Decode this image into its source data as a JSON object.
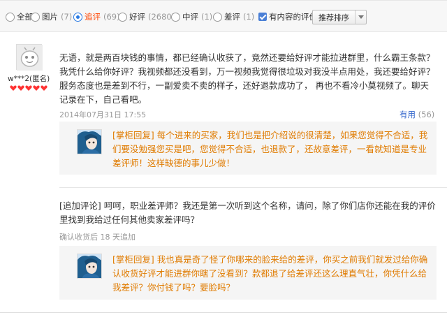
{
  "filters": {
    "all": {
      "label": "全部"
    },
    "pictures": {
      "label": "图片",
      "count": "(7)"
    },
    "followup": {
      "label": "追评",
      "count": "(69)"
    },
    "positive": {
      "label": "好评",
      "count": "(2680)"
    },
    "neutral": {
      "label": "中评",
      "count": "(1)"
    },
    "negative": {
      "label": "差评",
      "count": "(1)"
    },
    "with_content": {
      "label": "有内容的评价",
      "checked": true
    },
    "sort": {
      "selected": "推荐排序"
    },
    "selected_filter": "followup"
  },
  "review": {
    "username": "w***2(匿名)",
    "rank_icon_count": 5,
    "rank_color": "#ff3333",
    "text": "无语，就是两百块钱的事情，都已经确认收获了，竟然还要给好评才能拉进群里，什么霸王条款？我凭什么给你好评？我视频都还没看到，万一视频我觉得很垃圾对我没半点用处，我还要给好评？服务态度也是差到不行，一副爱卖不卖的样子，还好退款成功了， 再也不看冷小莫视频了。聊天记录在下，自己看吧。",
    "date": "2014年07月31日 17:55",
    "useful_label": "有用",
    "useful_count": "(56)",
    "reply": "[掌柜回复] 每个进来的买家，我们也是把介绍说的很清楚，如果您觉得不合适，我们要没勉强您买是吧，您觉得不合适，也退款了，还故意差评，一看就知道是专业差评师！这样缺德的事儿少做！",
    "followup": {
      "text": "[追加评论] 呵呵，职业差评师？我还是第一次听到这个名称，请问，除了你们店你还能在我的评价里找到我给过任何其他卖家差评吗？",
      "meta": "确认收货后 18 天追加",
      "reply": "[掌柜回复] 我也真是奇了怪了你哪来的脸来给的差评，你买之前我们就发过给你确认收货好评才能进群你瞎了没看到？款都退了给差评还这么理直气壮，你凭什么给我差评？你付钱了吗？要脸吗？"
    }
  },
  "colors": {
    "accent": "#ff4400",
    "reply": "#e07b00",
    "link": "#3366cc",
    "checkbox": "#4a7fd6"
  }
}
